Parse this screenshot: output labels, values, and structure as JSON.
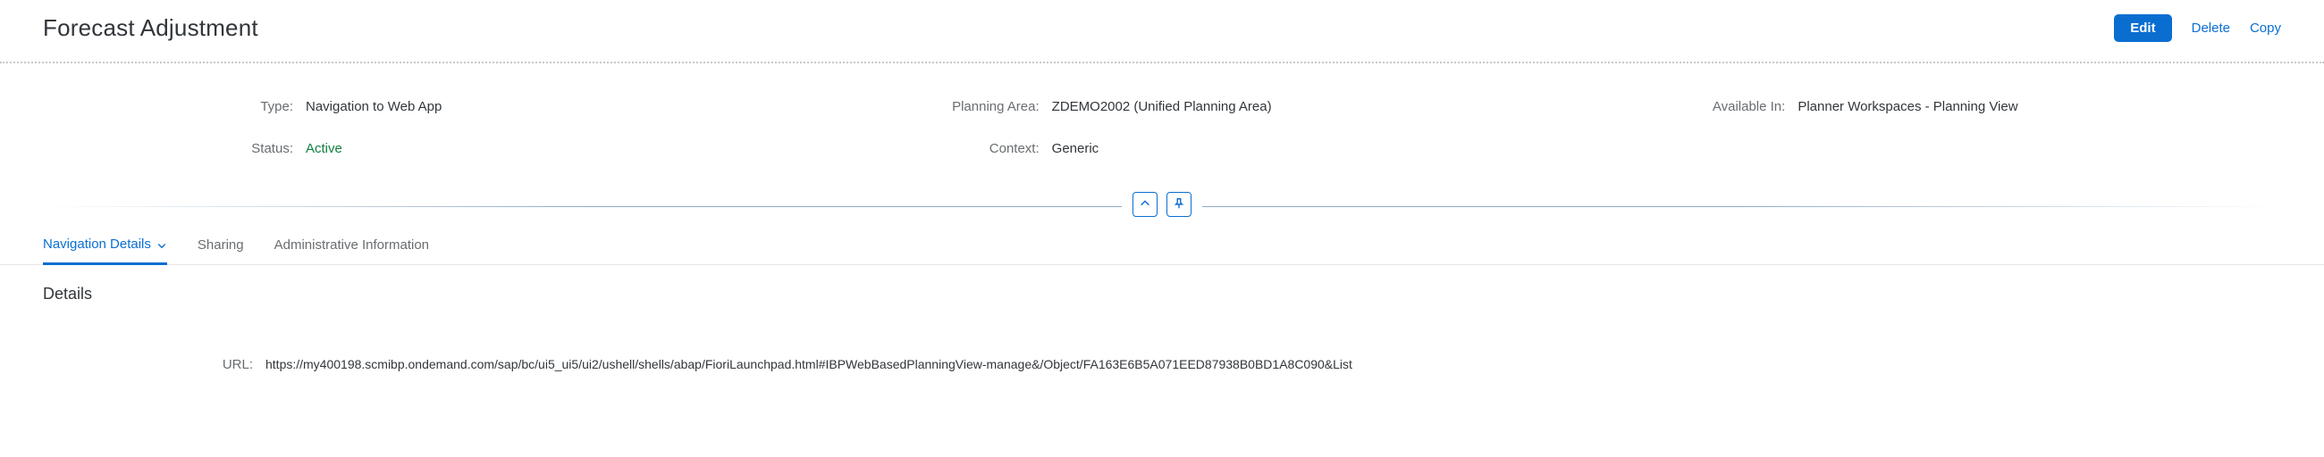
{
  "header": {
    "title": "Forecast Adjustment",
    "edit_label": "Edit",
    "delete_label": "Delete",
    "copy_label": "Copy"
  },
  "facts": {
    "type_label": "Type:",
    "type_value": "Navigation to Web App",
    "status_label": "Status:",
    "status_value": "Active",
    "planning_area_label": "Planning Area:",
    "planning_area_value": "ZDEMO2002 (Unified Planning Area)",
    "context_label": "Context:",
    "context_value": "Generic",
    "available_in_label": "Available In:",
    "available_in_value": "Planner Workspaces - Planning View"
  },
  "tabs": {
    "nav_details": "Navigation Details",
    "sharing": "Sharing",
    "admin_info": "Administrative Information"
  },
  "section": {
    "details_title": "Details",
    "url_label": "URL:",
    "url_value": "https://my400198.scmibp.ondemand.com/sap/bc/ui5_ui5/ui2/ushell/shells/abap/FioriLaunchpad.html#IBPWebBasedPlanningView-manage&/Object/FA163E6B5A071EED87938B0BD1A8C090&List"
  }
}
